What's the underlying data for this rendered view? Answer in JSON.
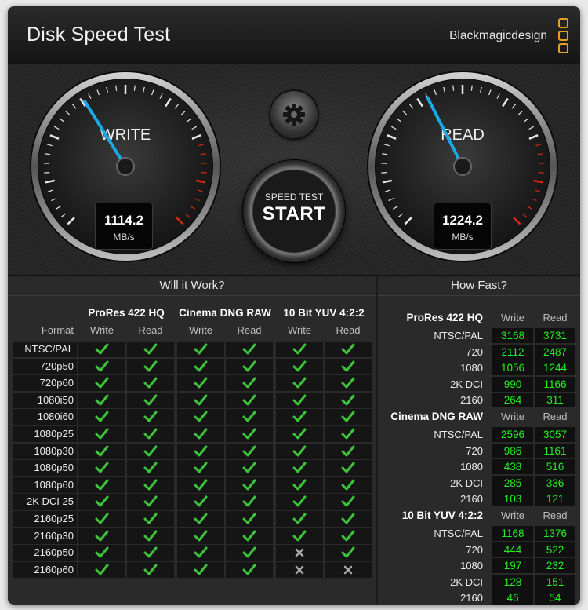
{
  "app": {
    "title": "Disk Speed Test",
    "brand": "Blackmagicdesign",
    "brand_color": "#e8a020"
  },
  "gauges": {
    "write": {
      "label": "WRITE",
      "value": "1114.2",
      "unit": "MB/s"
    },
    "read": {
      "label": "READ",
      "value": "1224.2",
      "unit": "MB/s"
    },
    "needle_color": "#1aa8e8",
    "redline_color": "#d42a10"
  },
  "controls": {
    "settings_icon": "gear-icon",
    "start_sub": "SPEED TEST",
    "start_main": "START"
  },
  "will_it_work": {
    "heading": "Will it Work?",
    "format_header": "Format",
    "write_header": "Write",
    "read_header": "Read",
    "codecs": [
      "ProRes 422 HQ",
      "Cinema DNG RAW",
      "10 Bit YUV 4:2:2"
    ],
    "ok_color": "#3ec43a",
    "fail_color": "#a8a8a8",
    "rows": [
      {
        "format": "NTSC/PAL",
        "results": [
          1,
          1,
          1,
          1,
          1,
          1
        ]
      },
      {
        "format": "720p50",
        "results": [
          1,
          1,
          1,
          1,
          1,
          1
        ]
      },
      {
        "format": "720p60",
        "results": [
          1,
          1,
          1,
          1,
          1,
          1
        ]
      },
      {
        "format": "1080i50",
        "results": [
          1,
          1,
          1,
          1,
          1,
          1
        ]
      },
      {
        "format": "1080i60",
        "results": [
          1,
          1,
          1,
          1,
          1,
          1
        ]
      },
      {
        "format": "1080p25",
        "results": [
          1,
          1,
          1,
          1,
          1,
          1
        ]
      },
      {
        "format": "1080p30",
        "results": [
          1,
          1,
          1,
          1,
          1,
          1
        ]
      },
      {
        "format": "1080p50",
        "results": [
          1,
          1,
          1,
          1,
          1,
          1
        ]
      },
      {
        "format": "1080p60",
        "results": [
          1,
          1,
          1,
          1,
          1,
          1
        ]
      },
      {
        "format": "2K DCI 25",
        "results": [
          1,
          1,
          1,
          1,
          1,
          1
        ]
      },
      {
        "format": "2160p25",
        "results": [
          1,
          1,
          1,
          1,
          1,
          1
        ]
      },
      {
        "format": "2160p30",
        "results": [
          1,
          1,
          1,
          1,
          1,
          1
        ]
      },
      {
        "format": "2160p50",
        "results": [
          1,
          1,
          1,
          1,
          0,
          1
        ]
      },
      {
        "format": "2160p60",
        "results": [
          1,
          1,
          1,
          1,
          0,
          0
        ]
      }
    ]
  },
  "how_fast": {
    "heading": "How Fast?",
    "write_header": "Write",
    "read_header": "Read",
    "groups": [
      {
        "codec": "ProRes 422 HQ",
        "rows": [
          {
            "res": "NTSC/PAL",
            "write": "3168",
            "read": "3731"
          },
          {
            "res": "720",
            "write": "2112",
            "read": "2487"
          },
          {
            "res": "1080",
            "write": "1056",
            "read": "1244"
          },
          {
            "res": "2K DCI",
            "write": "990",
            "read": "1166"
          },
          {
            "res": "2160",
            "write": "264",
            "read": "311"
          }
        ]
      },
      {
        "codec": "Cinema DNG RAW",
        "rows": [
          {
            "res": "NTSC/PAL",
            "write": "2596",
            "read": "3057"
          },
          {
            "res": "720",
            "write": "986",
            "read": "1161"
          },
          {
            "res": "1080",
            "write": "438",
            "read": "516"
          },
          {
            "res": "2K DCI",
            "write": "285",
            "read": "336"
          },
          {
            "res": "2160",
            "write": "103",
            "read": "121"
          }
        ]
      },
      {
        "codec": "10 Bit YUV 4:2:2",
        "rows": [
          {
            "res": "NTSC/PAL",
            "write": "1168",
            "read": "1376"
          },
          {
            "res": "720",
            "write": "444",
            "read": "522"
          },
          {
            "res": "1080",
            "write": "197",
            "read": "232"
          },
          {
            "res": "2K DCI",
            "write": "128",
            "read": "151"
          },
          {
            "res": "2160",
            "write": "46",
            "read": "54"
          }
        ]
      }
    ]
  }
}
